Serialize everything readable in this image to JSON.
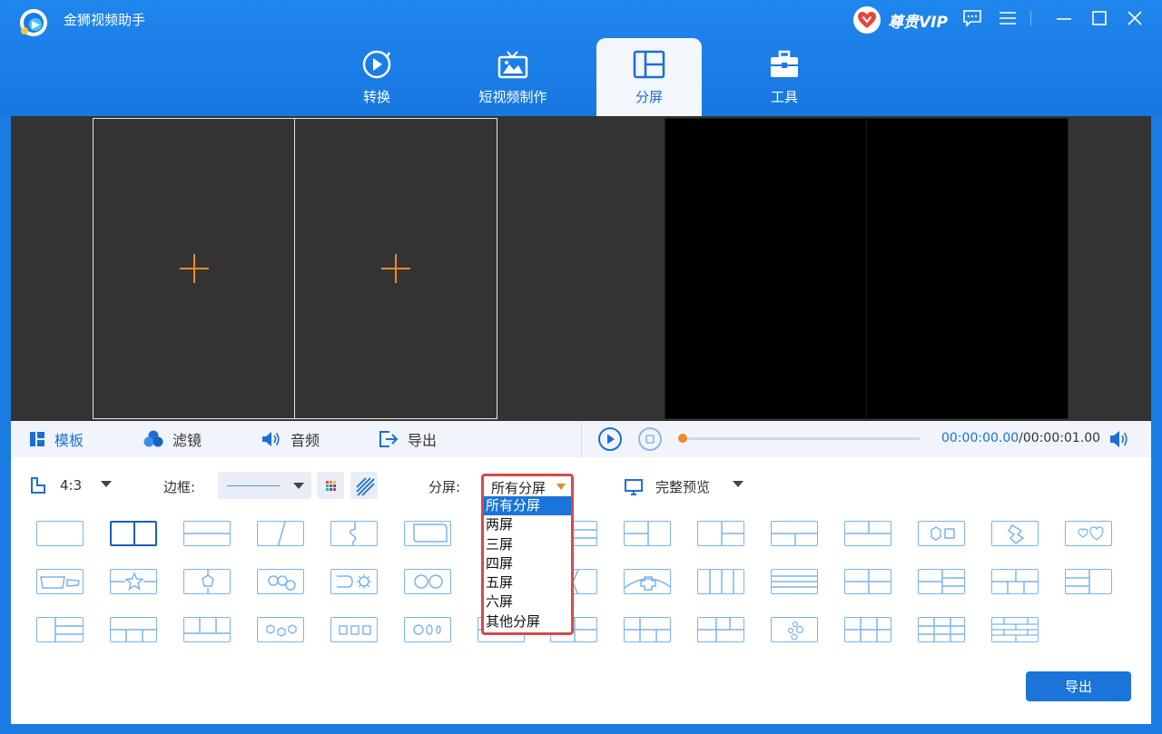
{
  "app": {
    "title": "金狮视频助手",
    "vip_label": "尊贵VIP"
  },
  "tabs": [
    {
      "label": "转换",
      "icon": "convert-icon"
    },
    {
      "label": "短视频制作",
      "icon": "tv-icon"
    },
    {
      "label": "分屏",
      "icon": "split-screen-icon",
      "active": true
    },
    {
      "label": "工具",
      "icon": "toolbox-icon"
    }
  ],
  "editor_tabs": [
    {
      "label": "模板",
      "icon": "template-icon",
      "active": true
    },
    {
      "label": "滤镜",
      "icon": "filter-icon"
    },
    {
      "label": "音频",
      "icon": "audio-icon"
    },
    {
      "label": "导出",
      "icon": "export-icon"
    }
  ],
  "player": {
    "current_time": "00:00:00.00",
    "separator": "/",
    "total_time": "00:00:01.00",
    "progress": 0
  },
  "settings": {
    "ratio": "4:3",
    "border_label": "边框:",
    "split_label": "分屏:",
    "split_value": "所有分屏",
    "split_options": [
      "所有分屏",
      "两屏",
      "三屏",
      "四屏",
      "五屏",
      "六屏",
      "其他分屏"
    ],
    "full_preview_label": "完整预览"
  },
  "export_button": "导出",
  "colors": {
    "accent": "#1a74da",
    "orange": "#f08a24",
    "highlight_border": "#d94848"
  }
}
